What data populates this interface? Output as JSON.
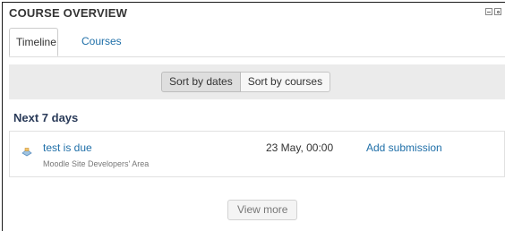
{
  "block": {
    "title": "COURSE OVERVIEW"
  },
  "tabs": [
    {
      "label": "Timeline",
      "active": true
    },
    {
      "label": "Courses",
      "active": false
    }
  ],
  "sort": {
    "by_dates_label": "Sort by dates",
    "by_courses_label": "Sort by courses",
    "active": "Sort by dates"
  },
  "section": {
    "title": "Next 7 days"
  },
  "events": [
    {
      "name": "test is due",
      "course": "Moodle Site Developers' Area",
      "date": "23 May, 00:00",
      "action": "Add submission",
      "icon": "assignment-icon"
    }
  ],
  "view_more_label": "View more",
  "colors": {
    "link": "#1f6fa8",
    "section_title": "#2a3b59",
    "sortbar_bg": "#ebebeb"
  }
}
